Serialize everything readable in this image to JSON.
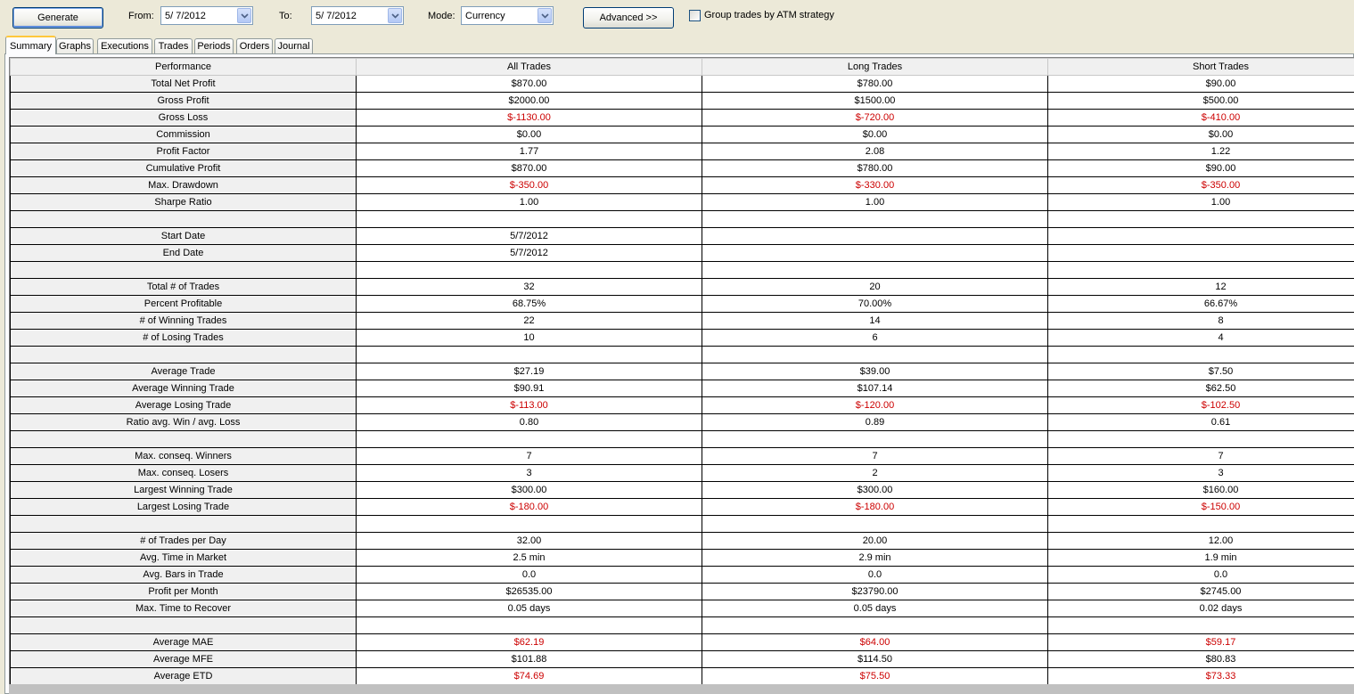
{
  "toolbar": {
    "generate_label": "Generate",
    "from_label": "From:",
    "from_value": "5/  7/2012",
    "to_label": "To:",
    "to_value": "5/  7/2012",
    "mode_label": "Mode:",
    "mode_value": "Currency",
    "advanced_label": "Advanced >>",
    "group_label": "Group trades by ATM strategy",
    "group_checked": false
  },
  "tabs": [
    {
      "label": "Summary",
      "active": true
    },
    {
      "label": "Graphs"
    },
    {
      "label": "Executions"
    },
    {
      "label": "Trades"
    },
    {
      "label": "Periods"
    },
    {
      "label": "Orders"
    },
    {
      "label": "Journal"
    }
  ],
  "table": {
    "columns": [
      "Performance",
      "All Trades",
      "Long Trades",
      "Short Trades"
    ],
    "rows": [
      {
        "label": "Total Net Profit",
        "values": [
          "$870.00",
          "$780.00",
          "$90.00"
        ]
      },
      {
        "label": "Gross Profit",
        "values": [
          "$2000.00",
          "$1500.00",
          "$500.00"
        ]
      },
      {
        "label": "Gross Loss",
        "values": [
          "$-1130.00",
          "$-720.00",
          "$-410.00"
        ],
        "negative": true
      },
      {
        "label": "Commission",
        "values": [
          "$0.00",
          "$0.00",
          "$0.00"
        ]
      },
      {
        "label": "Profit Factor",
        "values": [
          "1.77",
          "2.08",
          "1.22"
        ]
      },
      {
        "label": "Cumulative Profit",
        "values": [
          "$870.00",
          "$780.00",
          "$90.00"
        ]
      },
      {
        "label": "Max. Drawdown",
        "values": [
          "$-350.00",
          "$-330.00",
          "$-350.00"
        ],
        "negative": true
      },
      {
        "label": "Sharpe Ratio",
        "values": [
          "1.00",
          "1.00",
          "1.00"
        ]
      },
      {
        "label": "",
        "values": [
          "",
          "",
          ""
        ]
      },
      {
        "label": "Start Date",
        "values": [
          "5/7/2012",
          "",
          ""
        ]
      },
      {
        "label": "End Date",
        "values": [
          "5/7/2012",
          "",
          ""
        ]
      },
      {
        "label": "",
        "values": [
          "",
          "",
          ""
        ]
      },
      {
        "label": "Total # of Trades",
        "values": [
          "32",
          "20",
          "12"
        ]
      },
      {
        "label": "Percent Profitable",
        "values": [
          "68.75%",
          "70.00%",
          "66.67%"
        ]
      },
      {
        "label": "# of Winning Trades",
        "values": [
          "22",
          "14",
          "8"
        ]
      },
      {
        "label": "# of Losing Trades",
        "values": [
          "10",
          "6",
          "4"
        ]
      },
      {
        "label": "",
        "values": [
          "",
          "",
          ""
        ]
      },
      {
        "label": "Average Trade",
        "values": [
          "$27.19",
          "$39.00",
          "$7.50"
        ]
      },
      {
        "label": "Average Winning Trade",
        "values": [
          "$90.91",
          "$107.14",
          "$62.50"
        ]
      },
      {
        "label": "Average Losing Trade",
        "values": [
          "$-113.00",
          "$-120.00",
          "$-102.50"
        ],
        "negative": true
      },
      {
        "label": "Ratio avg. Win / avg. Loss",
        "values": [
          "0.80",
          "0.89",
          "0.61"
        ]
      },
      {
        "label": "",
        "values": [
          "",
          "",
          ""
        ]
      },
      {
        "label": "Max. conseq. Winners",
        "values": [
          "7",
          "7",
          "7"
        ]
      },
      {
        "label": "Max. conseq. Losers",
        "values": [
          "3",
          "2",
          "3"
        ]
      },
      {
        "label": "Largest Winning Trade",
        "values": [
          "$300.00",
          "$300.00",
          "$160.00"
        ]
      },
      {
        "label": "Largest Losing Trade",
        "values": [
          "$-180.00",
          "$-180.00",
          "$-150.00"
        ],
        "negative": true
      },
      {
        "label": "",
        "values": [
          "",
          "",
          ""
        ]
      },
      {
        "label": "# of Trades per Day",
        "values": [
          "32.00",
          "20.00",
          "12.00"
        ]
      },
      {
        "label": "Avg. Time in Market",
        "values": [
          "2.5 min",
          "2.9 min",
          "1.9 min"
        ]
      },
      {
        "label": "Avg. Bars in Trade",
        "values": [
          "0.0",
          "0.0",
          "0.0"
        ]
      },
      {
        "label": "Profit per Month",
        "values": [
          "$26535.00",
          "$23790.00",
          "$2745.00"
        ]
      },
      {
        "label": "Max. Time to Recover",
        "values": [
          "0.05 days",
          "0.05 days",
          "0.02 days"
        ]
      },
      {
        "label": "",
        "values": [
          "",
          "",
          ""
        ]
      },
      {
        "label": "Average MAE",
        "values": [
          "$62.19",
          "$64.00",
          "$59.17"
        ],
        "negative": true
      },
      {
        "label": "Average MFE",
        "values": [
          "$101.88",
          "$114.50",
          "$80.83"
        ]
      },
      {
        "label": "Average ETD",
        "values": [
          "$74.69",
          "$75.50",
          "$73.33"
        ],
        "negative": true
      }
    ]
  },
  "colors": {
    "negative_text": "#cc0000",
    "window_bg": "#ece9d8",
    "tab_highlight": "#ffc83c",
    "input_border": "#7f9db9"
  }
}
